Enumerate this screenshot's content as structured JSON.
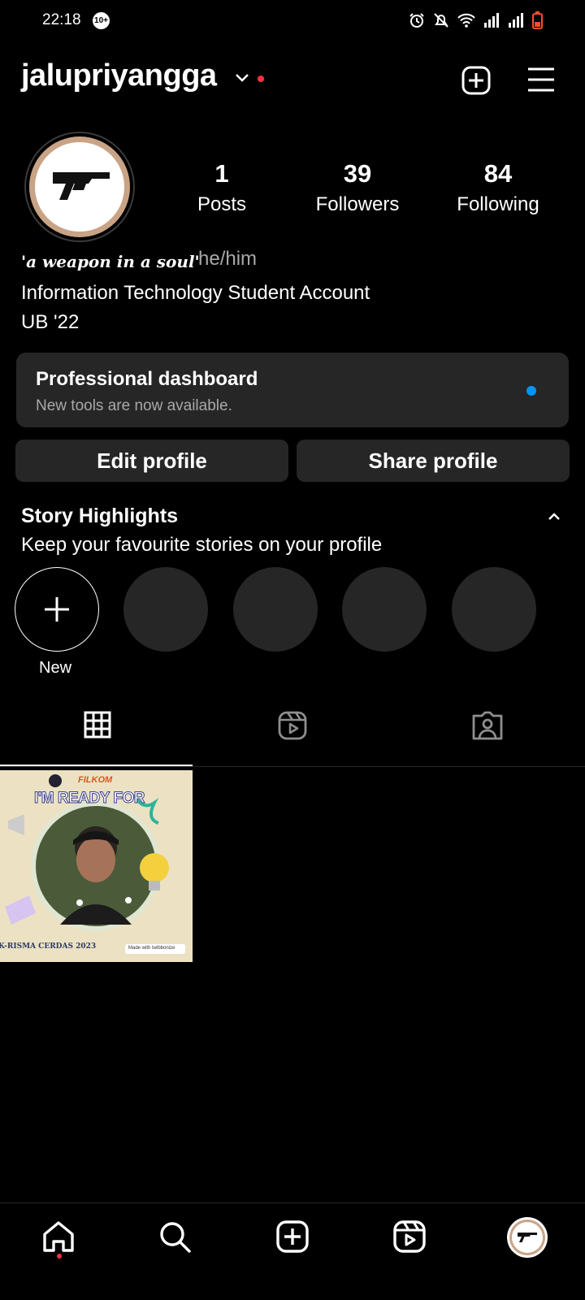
{
  "status_bar": {
    "time": "22:18",
    "badge": "10+"
  },
  "header": {
    "username": "jalupriyangga"
  },
  "profile": {
    "stats": [
      {
        "value": "1",
        "label": "Posts"
      },
      {
        "value": "39",
        "label": "Followers"
      },
      {
        "value": "84",
        "label": "Following"
      }
    ],
    "bio_tag": "'a weapon in a soul'",
    "pronouns": "he/him",
    "bio_lines": [
      "Information Technology Student Account",
      "UB '22"
    ]
  },
  "dashboard": {
    "title": "Professional dashboard",
    "subtitle": "New tools are now available."
  },
  "buttons": {
    "edit": "Edit profile",
    "share": "Share profile"
  },
  "highlights": {
    "title": "Story Highlights",
    "subtitle": "Keep your favourite stories on your profile",
    "new_label": "New"
  },
  "post": {
    "top_label": "FILKOM",
    "headline": "I'M READY FOR",
    "bottom_label": "K-RISMA CERDAS 2023",
    "made_with": "Made with twibbonize"
  },
  "colors": {
    "accent": "#0095f6",
    "notification": "#ff3040",
    "surface": "#262626"
  }
}
